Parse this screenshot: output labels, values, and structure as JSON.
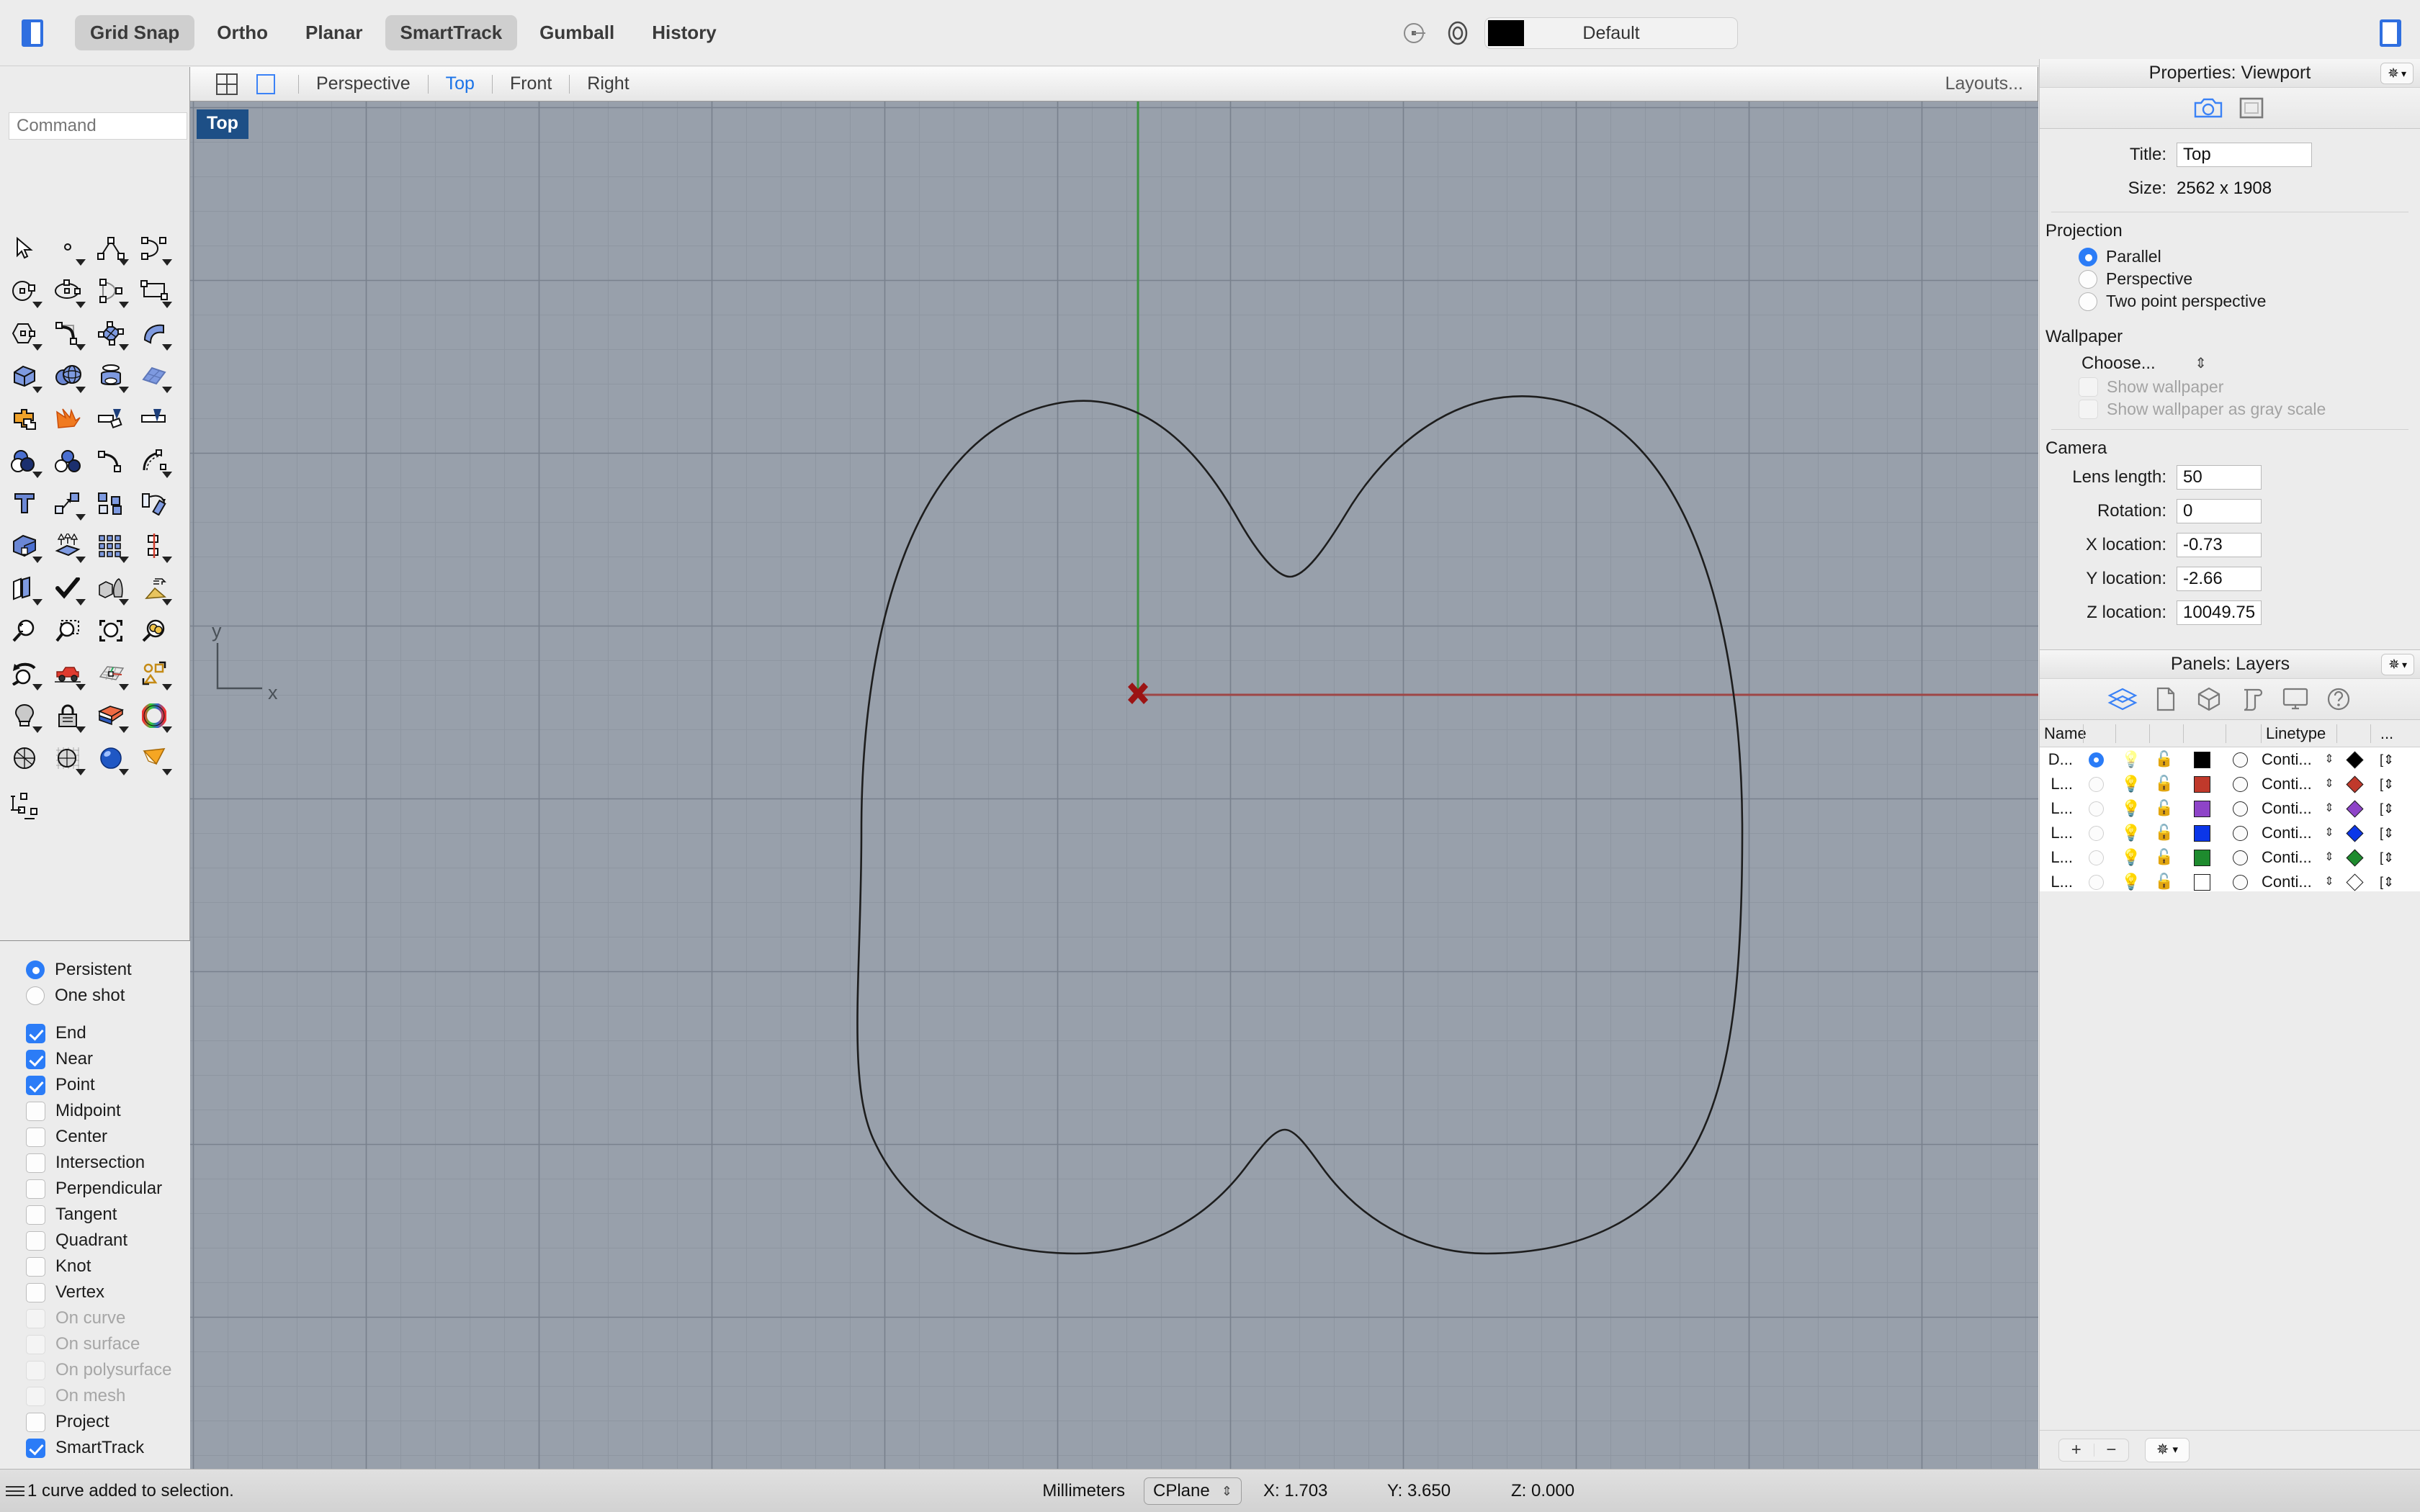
{
  "topbar": {
    "left_panel_toggle": "left-panel-toggle",
    "right_panel_toggle": "right-panel-toggle",
    "toggles": [
      {
        "label": "Grid Snap",
        "on": true
      },
      {
        "label": "Ortho",
        "on": false
      },
      {
        "label": "Planar",
        "on": false
      },
      {
        "label": "SmartTrack",
        "on": true
      },
      {
        "label": "Gumball",
        "on": false
      },
      {
        "label": "History",
        "on": false
      }
    ],
    "layer_swatch_color": "#000000",
    "layer_name": "Default"
  },
  "viewport_tabs": {
    "names": [
      {
        "label": "Perspective",
        "active": false
      },
      {
        "label": "Top",
        "active": true
      },
      {
        "label": "Front",
        "active": false
      },
      {
        "label": "Right",
        "active": false
      }
    ],
    "layouts_label": "Layouts..."
  },
  "command": {
    "placeholder": "Command",
    "value": ""
  },
  "viewport": {
    "label": "Top",
    "background_color": "#98a0ab",
    "grid_color": "#8e96a1",
    "grid_major_color": "#7f8894",
    "x_axis_color": "#9e4646",
    "y_axis_color": "#3c9440",
    "curve_color": "#202020",
    "origin_marker_color": "#9c1414",
    "axis_indicator": {
      "x": "x",
      "y": "y"
    }
  },
  "osnap": {
    "mode": [
      {
        "label": "Persistent",
        "on": true
      },
      {
        "label": "One shot",
        "on": false
      }
    ],
    "snaps": [
      {
        "label": "End",
        "checked": true,
        "disabled": false
      },
      {
        "label": "Near",
        "checked": true,
        "disabled": false
      },
      {
        "label": "Point",
        "checked": true,
        "disabled": false
      },
      {
        "label": "Midpoint",
        "checked": false,
        "disabled": false
      },
      {
        "label": "Center",
        "checked": false,
        "disabled": false
      },
      {
        "label": "Intersection",
        "checked": false,
        "disabled": false
      },
      {
        "label": "Perpendicular",
        "checked": false,
        "disabled": false
      },
      {
        "label": "Tangent",
        "checked": false,
        "disabled": false
      },
      {
        "label": "Quadrant",
        "checked": false,
        "disabled": false
      },
      {
        "label": "Knot",
        "checked": false,
        "disabled": false
      },
      {
        "label": "Vertex",
        "checked": false,
        "disabled": false
      },
      {
        "label": "On curve",
        "checked": false,
        "disabled": true
      },
      {
        "label": "On surface",
        "checked": false,
        "disabled": true
      },
      {
        "label": "On polysurface",
        "checked": false,
        "disabled": true
      },
      {
        "label": "On mesh",
        "checked": false,
        "disabled": true
      },
      {
        "label": "Project",
        "checked": false,
        "disabled": false
      },
      {
        "label": "SmartTrack",
        "checked": true,
        "disabled": false
      }
    ]
  },
  "properties": {
    "title": "Properties: Viewport",
    "title_label": "Title:",
    "title_value": "Top",
    "size_label": "Size:",
    "size_value": "2562 x 1908",
    "projection_section": "Projection",
    "projection_options": [
      {
        "label": "Parallel",
        "on": true
      },
      {
        "label": "Perspective",
        "on": false
      },
      {
        "label": "Two point perspective",
        "on": false
      }
    ],
    "wallpaper_section": "Wallpaper",
    "wallpaper_choose": "Choose...",
    "wallpaper_checks": [
      {
        "label": "Show wallpaper",
        "checked": false,
        "disabled": true
      },
      {
        "label": "Show wallpaper as gray scale",
        "checked": false,
        "disabled": true
      }
    ],
    "camera_section": "Camera",
    "camera_fields": [
      {
        "label": "Lens length:",
        "value": "50"
      },
      {
        "label": "Rotation:",
        "value": "0"
      },
      {
        "label": "X location:",
        "value": "-0.73"
      },
      {
        "label": "Y location:",
        "value": "-2.66"
      },
      {
        "label": "Z location:",
        "value": "10049.75"
      }
    ]
  },
  "layers": {
    "title": "Panels: Layers",
    "columns": [
      "Name",
      "Linetype",
      "..."
    ],
    "rows": [
      {
        "name": "D...",
        "current": true,
        "color": "#000000",
        "linetype": "Conti...",
        "print_color": "#000000"
      },
      {
        "name": "L...",
        "current": false,
        "color": "#c0392b",
        "linetype": "Conti...",
        "print_color": "#c0392b"
      },
      {
        "name": "L...",
        "current": false,
        "color": "#8e44c8",
        "linetype": "Conti...",
        "print_color": "#8e44c8"
      },
      {
        "name": "L...",
        "current": false,
        "color": "#0b36e8",
        "linetype": "Conti...",
        "print_color": "#0b36e8"
      },
      {
        "name": "L...",
        "current": false,
        "color": "#1e8b2e",
        "linetype": "Conti...",
        "print_color": "#1e8b2e"
      },
      {
        "name": "L...",
        "current": false,
        "color": "#ffffff",
        "linetype": "Conti...",
        "print_color": "#ffffff"
      }
    ],
    "footer": {
      "add": "+",
      "remove": "−"
    }
  },
  "statusbar": {
    "message": "1 curve added to selection.",
    "units": "Millimeters",
    "cplane": "CPlane",
    "x": "X: 1.703",
    "y": "Y: 3.650",
    "z": "Z: 0.000"
  }
}
